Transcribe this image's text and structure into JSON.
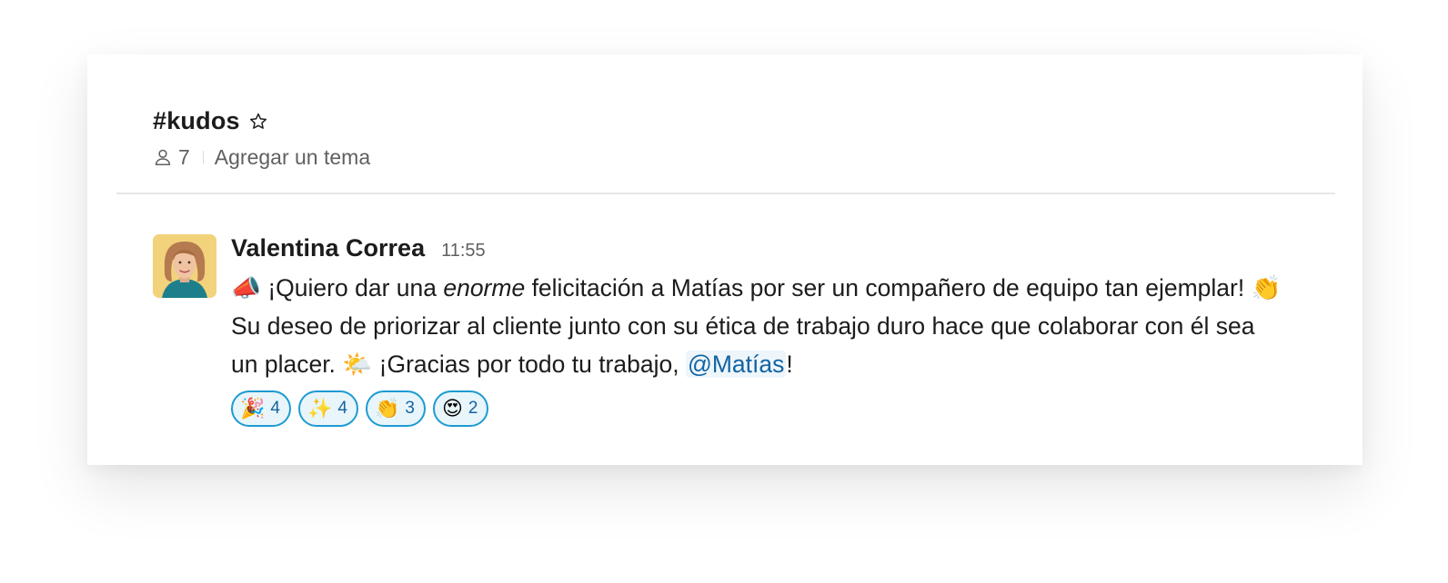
{
  "channel": {
    "name": "#kudos",
    "member_count": "7",
    "topic_link": "Agregar un tema"
  },
  "message": {
    "sender": "Valentina Correa",
    "time": "11:55",
    "line1_emoji": "📣",
    "line1_pre": " ¡Quiero dar una ",
    "line1_italic": "enorme",
    "line1_post": " felicitación a Matías por ser un compañero de equipo tan ejemplar! ",
    "line1_end_emoji": "👏",
    "line2": "Su deseo de priorizar al cliente junto con su ética de trabajo duro hace que colaborar con él sea",
    "line3_pre": "un placer. ",
    "line3_emoji": "🌤️",
    "line3_mid": " ¡Gracias por todo tu trabajo, ",
    "mention": "@Matías",
    "line3_end": "!"
  },
  "reactions": [
    {
      "emoji": "🎉",
      "count": "4"
    },
    {
      "emoji": "✨",
      "count": "4"
    },
    {
      "emoji": "👏",
      "count": "3"
    },
    {
      "emoji": "😍",
      "count": "2"
    }
  ],
  "colors": {
    "accent_border": "#1d9bd1",
    "mention_text": "#1264a3",
    "primary_text": "#1d1c1d",
    "secondary_text": "#616061"
  }
}
